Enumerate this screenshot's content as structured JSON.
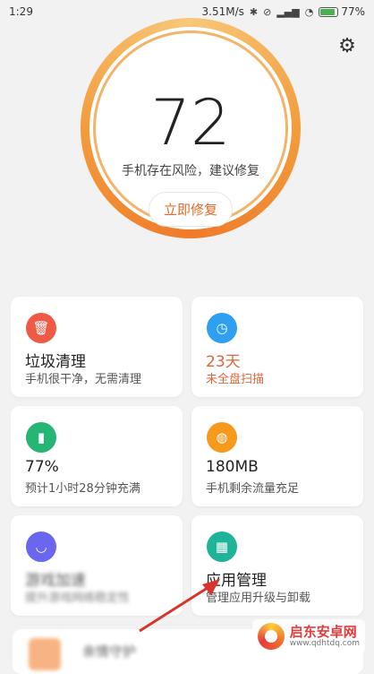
{
  "status": {
    "time": "1:29",
    "network_speed": "3.51M/s",
    "battery": "77%",
    "battery_level": 0.77,
    "icons": [
      "bluetooth-icon",
      "alarm-muted-icon",
      "signal-icon",
      "wifi-icon",
      "battery-icon"
    ]
  },
  "header": {
    "settings_icon": "gear-icon"
  },
  "score": {
    "value": "72",
    "subtitle": "手机存在风险，建议修复",
    "button_label": "立即修复",
    "ring_colors": [
      "#f7c87a",
      "#f39c3c",
      "#f07a2a"
    ]
  },
  "cards": [
    {
      "title": "垃圾清理",
      "subtitle": "手机很干净，无需清理",
      "icon": "trash-icon",
      "color": "#ee5a46",
      "title_color": "#222222",
      "sub_color": "#555555"
    },
    {
      "title": "23天",
      "subtitle": "未全盘扫描",
      "icon": "timer-icon",
      "color": "#2f9ff2",
      "title_color": "#e0663a",
      "sub_color": "#e0663a"
    },
    {
      "title": "77%",
      "subtitle": "预计1小时28分钟充满",
      "icon": "battery-icon",
      "color": "#25b575",
      "title_color": "#222222",
      "sub_color": "#555555"
    },
    {
      "title": "180MB",
      "subtitle": "手机剩余流量充足",
      "icon": "droplet-icon",
      "color": "#f59a1b",
      "title_color": "#222222",
      "sub_color": "#555555"
    },
    {
      "title": "游戏加速",
      "subtitle": "提升游戏网络稳定性",
      "icon": "gamepad-icon",
      "color": "#6b66ef",
      "title_color": "#222222",
      "sub_color": "#555555"
    },
    {
      "title": "应用管理",
      "subtitle": "管理应用升级与卸载",
      "icon": "grid-icon",
      "color": "#1fb39a",
      "title_color": "#222222",
      "sub_color": "#555555"
    }
  ],
  "bottom_item": {
    "label": "亲情守护"
  },
  "watermark": {
    "name": "启东安卓网",
    "url": "www.qdhtdq.com"
  }
}
